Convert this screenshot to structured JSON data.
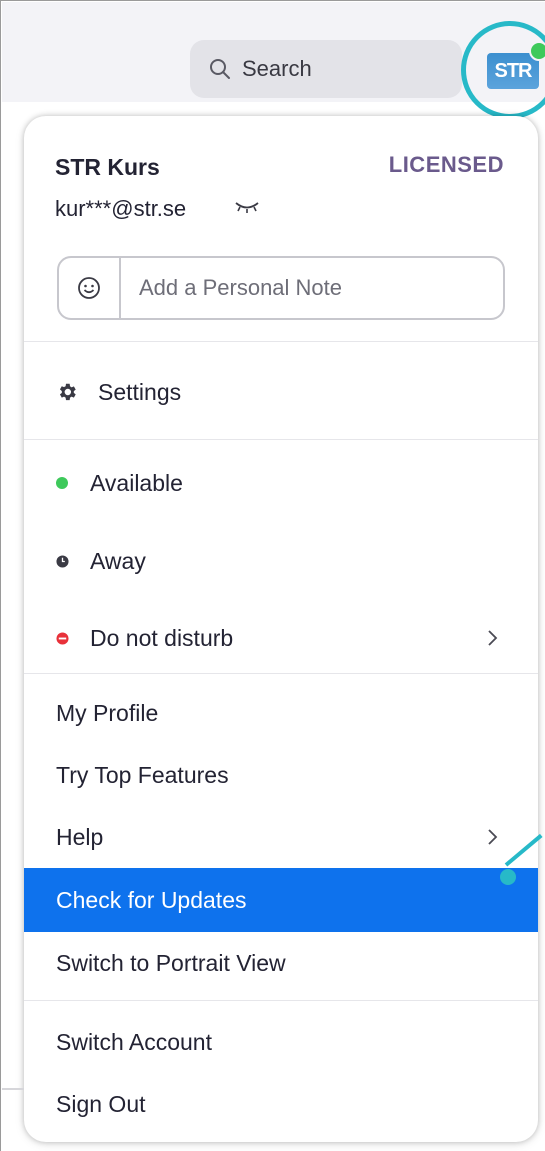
{
  "search": {
    "label": "Search",
    "icon": "search-icon"
  },
  "avatar": {
    "initials": "STR",
    "status_color": "#3ec95b",
    "ring_color": "#27b9c8"
  },
  "profile": {
    "name": "STR Kurs",
    "license": "LICENSED",
    "email": "kur***@str.se",
    "note_placeholder": "Add a Personal Note"
  },
  "menu": {
    "settings": "Settings",
    "status": {
      "available": "Available",
      "away": "Away",
      "dnd": "Do not disturb"
    },
    "my_profile": "My Profile",
    "top_features": "Try Top Features",
    "help": "Help",
    "check_updates": "Check for Updates",
    "portrait_view": "Switch to Portrait View",
    "switch_account": "Switch Account",
    "sign_out": "Sign Out"
  },
  "colors": {
    "highlight": "#0e72ed",
    "available": "#3ec95b",
    "away": "#3a3a44",
    "dnd": "#e8313a",
    "accent": "#27b9c8"
  }
}
